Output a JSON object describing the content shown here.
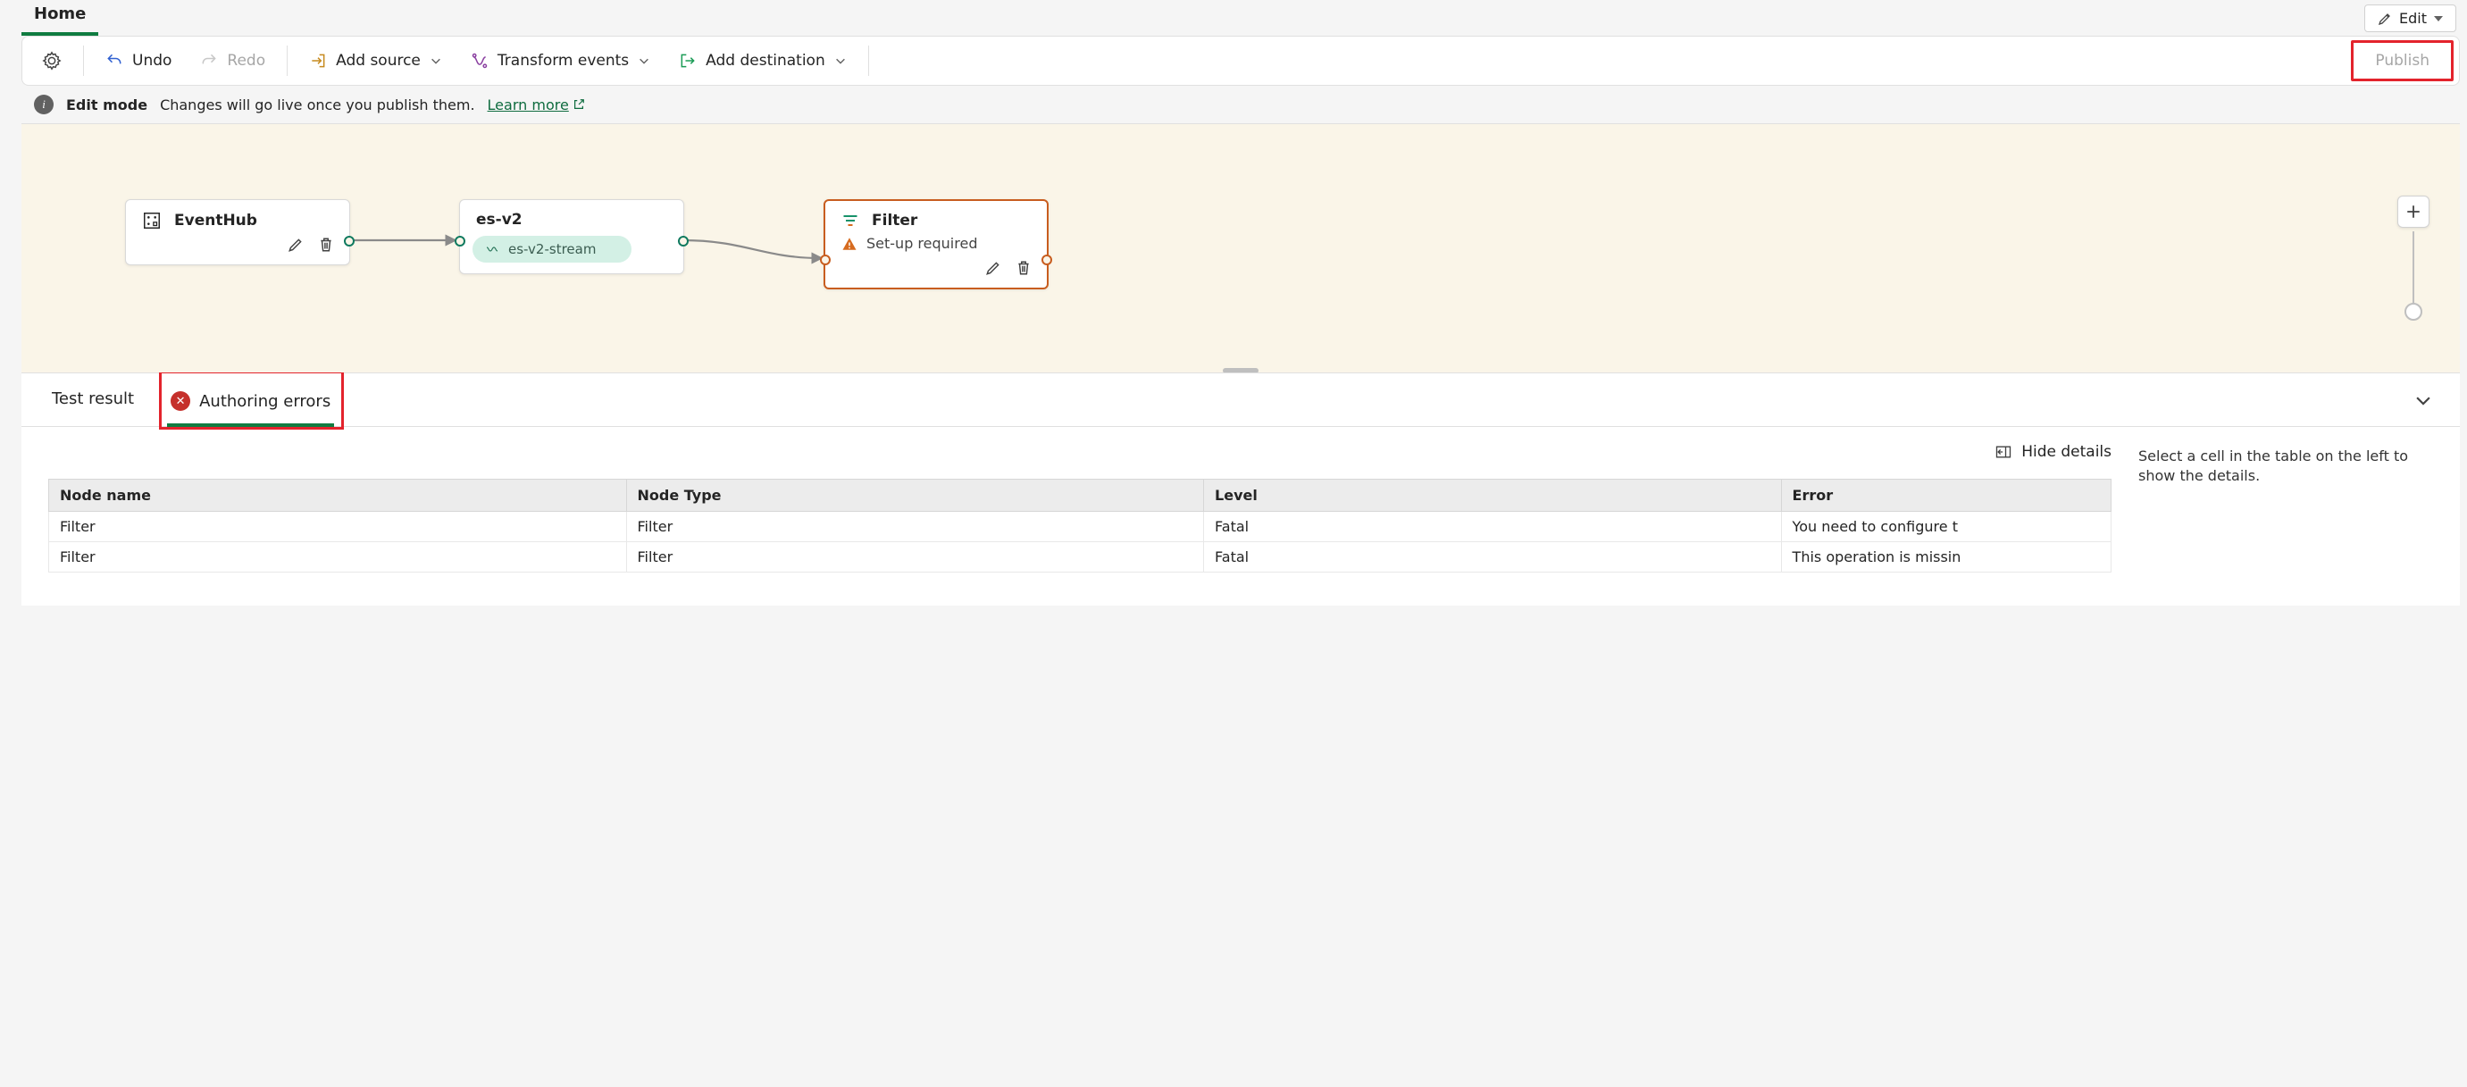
{
  "header": {
    "tab": "Home",
    "edit_label": "Edit"
  },
  "toolbar": {
    "undo": "Undo",
    "redo": "Redo",
    "add_source": "Add source",
    "transform": "Transform events",
    "add_destination": "Add destination",
    "publish": "Publish"
  },
  "banner": {
    "title": "Edit mode",
    "message": "Changes will go live once you publish them.",
    "learn_more": "Learn more"
  },
  "canvas": {
    "node_eventhub": {
      "title": "EventHub"
    },
    "node_esv2": {
      "title": "es-v2",
      "stream": "es-v2-stream"
    },
    "node_filter": {
      "title": "Filter",
      "status": "Set-up required"
    }
  },
  "bottom": {
    "tab_test": "Test result",
    "tab_errors": "Authoring errors",
    "hide_details": "Hide details",
    "side_msg": "Select a cell in the table on the left to show the details.",
    "columns": {
      "c0": "Node name",
      "c1": "Node Type",
      "c2": "Level",
      "c3": "Error"
    },
    "rows": [
      {
        "name": "Filter",
        "type": "Filter",
        "level": "Fatal",
        "error": "You need to configure t"
      },
      {
        "name": "Filter",
        "type": "Filter",
        "level": "Fatal",
        "error": "This operation is missin"
      }
    ]
  }
}
